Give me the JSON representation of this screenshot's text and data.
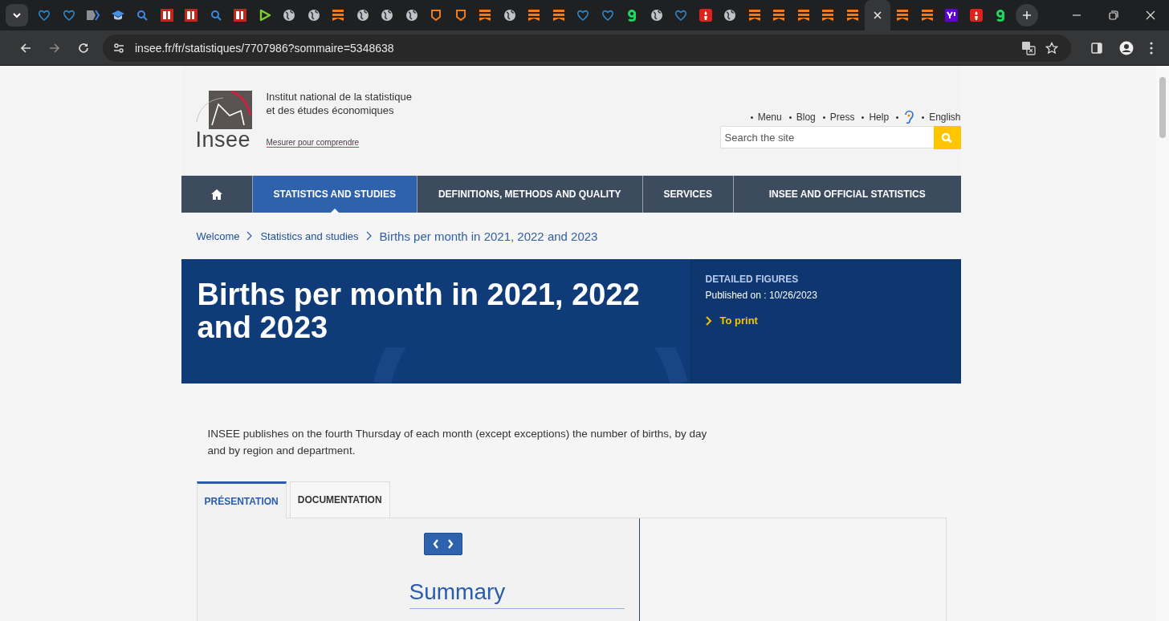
{
  "browser": {
    "tabs": [
      {
        "kind": "shield",
        "selected": false
      },
      {
        "kind": "shield",
        "selected": false
      },
      {
        "kind": "doc",
        "selected": false
      },
      {
        "kind": "cap",
        "selected": false
      },
      {
        "kind": "search",
        "selected": false
      },
      {
        "kind": "bi",
        "selected": false
      },
      {
        "kind": "bi",
        "selected": false
      },
      {
        "kind": "search",
        "selected": false
      },
      {
        "kind": "bi",
        "selected": false
      },
      {
        "kind": "play",
        "selected": false
      },
      {
        "kind": "globe",
        "selected": false
      },
      {
        "kind": "globe",
        "selected": false
      },
      {
        "kind": "bookmark",
        "selected": false
      },
      {
        "kind": "globe",
        "selected": false
      },
      {
        "kind": "globe",
        "selected": false
      },
      {
        "kind": "globe",
        "selected": false
      },
      {
        "kind": "badge",
        "selected": false
      },
      {
        "kind": "badge",
        "selected": false
      },
      {
        "kind": "bookmark",
        "selected": false
      },
      {
        "kind": "globe",
        "selected": false
      },
      {
        "kind": "bookmark",
        "selected": false
      },
      {
        "kind": "bookmark",
        "selected": false
      },
      {
        "kind": "shield",
        "selected": false
      },
      {
        "kind": "shield",
        "selected": false
      },
      {
        "kind": "g",
        "selected": false
      },
      {
        "kind": "globe",
        "selected": false
      },
      {
        "kind": "shield",
        "selected": false
      },
      {
        "kind": "pin",
        "selected": false
      },
      {
        "kind": "globe",
        "selected": false
      },
      {
        "kind": "bookmark",
        "selected": false
      },
      {
        "kind": "bookmark",
        "selected": false
      },
      {
        "kind": "bookmark",
        "selected": false
      },
      {
        "kind": "bookmark",
        "selected": false
      },
      {
        "kind": "bookmark",
        "selected": false
      },
      {
        "selected": true
      },
      {
        "kind": "bookmark",
        "selected": false
      },
      {
        "kind": "bookmark",
        "selected": false
      },
      {
        "kind": "yahoo",
        "selected": false
      },
      {
        "kind": "pin",
        "selected": false
      },
      {
        "kind": "g",
        "selected": false
      }
    ],
    "address": "insee.fr/fr/statistiques/7707986?sommaire=5348638"
  },
  "header": {
    "logo_text": "Insee",
    "institute_lines": [
      "Institut national de la statistique",
      "et des études économiques"
    ],
    "tagline": "Mesurer pour comprendre",
    "links": [
      {
        "kind": "text",
        "label": "Menu"
      },
      {
        "kind": "text",
        "label": "Blog"
      },
      {
        "kind": "text",
        "label": "Press"
      },
      {
        "kind": "text",
        "label": "Help"
      },
      {
        "kind": "ear"
      },
      {
        "kind": "text",
        "label": "English"
      }
    ],
    "search": {
      "placeholder": "Search the site"
    }
  },
  "nav": [
    {
      "kind": "home",
      "selected": false
    },
    {
      "kind": "text",
      "label": "STATISTICS AND STUDIES",
      "selected": true
    },
    {
      "kind": "text",
      "label": "DEFINITIONS, METHODS AND QUALITY",
      "selected": false
    },
    {
      "kind": "text",
      "label": "SERVICES",
      "selected": false
    },
    {
      "kind": "text",
      "label": "INSEE AND OFFICIAL STATISTICS",
      "selected": false
    }
  ],
  "breadcrumb": [
    "Welcome",
    "Statistics and studies",
    "Births per month in 2021, 2022 and 2023"
  ],
  "hero": {
    "title": "Births per month in 2021, 2022 and 2023",
    "category": "DETAILED FIGURES",
    "published": "Published on : 10/26/2023",
    "print_link": "To print"
  },
  "intro": "INSEE publishes on the fourth Thursday of each month (except exceptions) the number of births, by day and by region and department.",
  "content_tabs": [
    {
      "label": "PRÉSENTATION",
      "selected": true
    },
    {
      "label": "DOCUMENTATION",
      "selected": false
    }
  ],
  "summary": {
    "title": "Summary"
  }
}
